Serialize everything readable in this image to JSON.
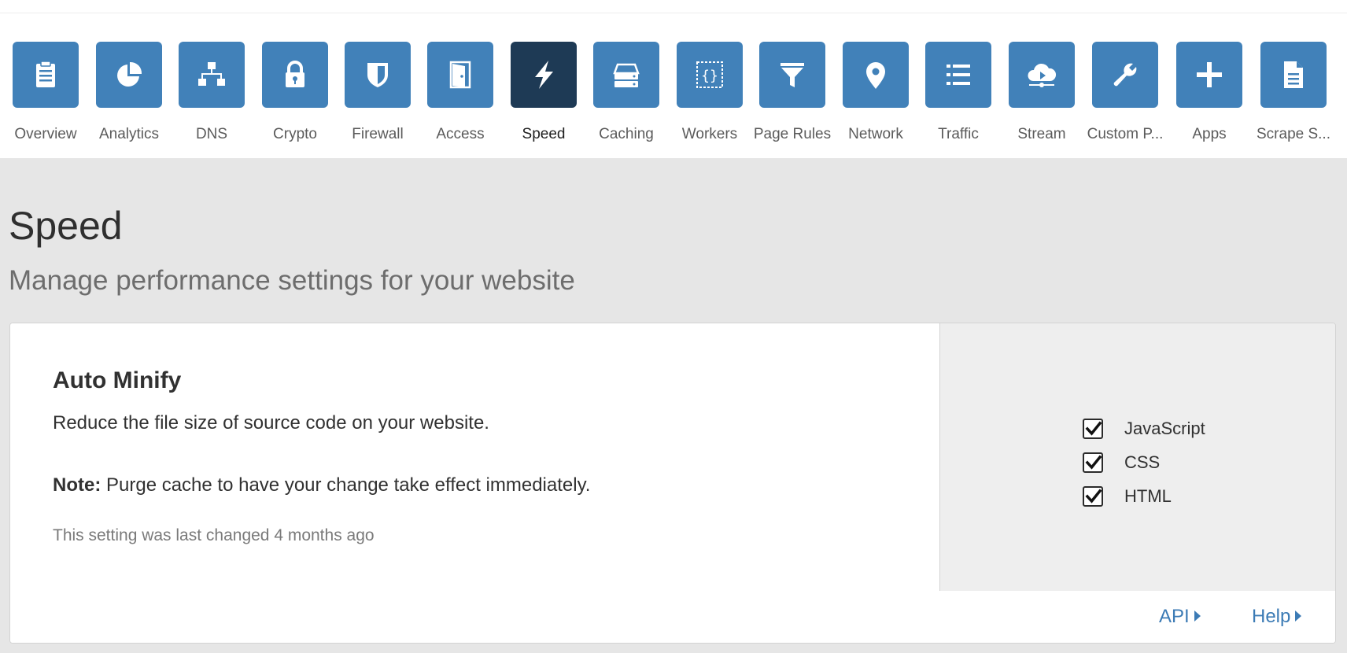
{
  "nav": {
    "items": [
      {
        "label": "Overview",
        "icon": "clipboard-icon",
        "active": false
      },
      {
        "label": "Analytics",
        "icon": "pie-chart-icon",
        "active": false
      },
      {
        "label": "DNS",
        "icon": "sitemap-icon",
        "active": false
      },
      {
        "label": "Crypto",
        "icon": "lock-icon",
        "active": false
      },
      {
        "label": "Firewall",
        "icon": "shield-icon",
        "active": false
      },
      {
        "label": "Access",
        "icon": "door-icon",
        "active": false
      },
      {
        "label": "Speed",
        "icon": "lightning-icon",
        "active": true
      },
      {
        "label": "Caching",
        "icon": "server-icon",
        "active": false
      },
      {
        "label": "Workers",
        "icon": "braces-icon",
        "active": false
      },
      {
        "label": "Page Rules",
        "icon": "filter-icon",
        "active": false
      },
      {
        "label": "Network",
        "icon": "map-pin-icon",
        "active": false
      },
      {
        "label": "Traffic",
        "icon": "list-icon",
        "active": false
      },
      {
        "label": "Stream",
        "icon": "cloud-play-icon",
        "active": false
      },
      {
        "label": "Custom P...",
        "icon": "wrench-icon",
        "active": false
      },
      {
        "label": "Apps",
        "icon": "plus-icon",
        "active": false
      },
      {
        "label": "Scrape S...",
        "icon": "document-icon",
        "active": false
      }
    ],
    "tile_color": "#4181b9",
    "active_tile_color": "#1e3a55"
  },
  "page": {
    "title": "Speed",
    "subtitle": "Manage performance settings for your website"
  },
  "auto_minify": {
    "title": "Auto Minify",
    "description": "Reduce the file size of source code on your website.",
    "note_label": "Note:",
    "note_text": " Purge cache to have your change take effect immediately.",
    "last_changed": "This setting was last changed 4 months ago",
    "options": [
      {
        "label": "JavaScript",
        "checked": true
      },
      {
        "label": "CSS",
        "checked": true
      },
      {
        "label": "HTML",
        "checked": true
      }
    ]
  },
  "footer": {
    "api_label": "API",
    "help_label": "Help",
    "link_color": "#3c7bb5"
  }
}
